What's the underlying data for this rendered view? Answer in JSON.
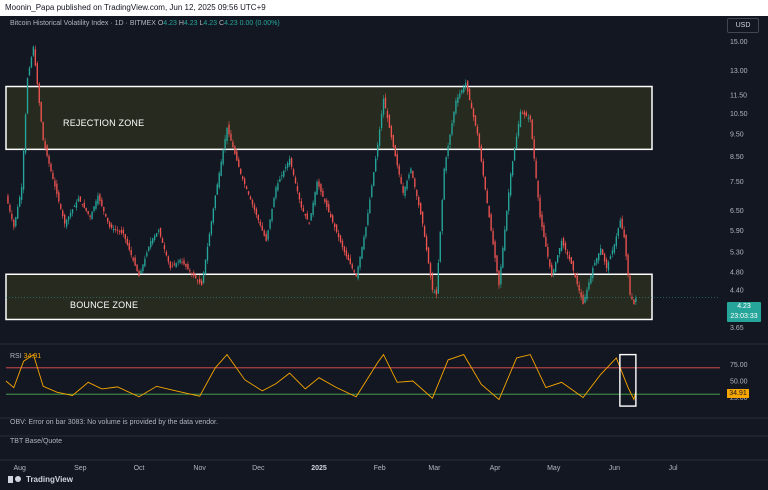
{
  "header": {
    "published_text": "Moonin_Papa published on TradingView.com, Jun 12, 2025 09:56 UTC+9"
  },
  "legend": {
    "symbol": "Bitcoin Historical Volatility Index · 1D · BITMEX",
    "open_label": "O",
    "open": "4.23",
    "high_label": "H",
    "high": "4.23",
    "low_label": "L",
    "low": "4.23",
    "close_label": "C",
    "close": "4.23",
    "change": "0.00 (0.00%)"
  },
  "currency_button": "USD",
  "price_tag": {
    "value": "4.23",
    "countdown": "23:03:33"
  },
  "zones": {
    "rejection": "REJECTION ZONE",
    "bounce": "BOUNCE ZONE"
  },
  "rsi_panel": {
    "label": "RSI",
    "value": "34.91",
    "tag": "34.91"
  },
  "obv_panel": {
    "text": "OBV: Error on bar 3083: No volume is provided by the data vendor."
  },
  "tbt_panel": {
    "text": "TBT Base/Quote"
  },
  "brand": {
    "name": "TradingView"
  },
  "colors": {
    "background": "#131722",
    "bull": "#26a69a",
    "bear": "#ef5350",
    "rsi_line": "#f7a600",
    "zone_fill": "#2a2e1e",
    "zone_border": "#ffffff",
    "rsi_upper": "#ef5350",
    "rsi_lower": "#4caf50"
  },
  "chart_data": [
    {
      "type": "candlestick",
      "title": "",
      "y_scale": "log",
      "ylim": [
        3.4,
        16.5
      ],
      "y_ticks": [
        "15.00",
        "13.00",
        "11.50",
        "10.50",
        "9.50",
        "8.50",
        "7.50",
        "6.50",
        "5.90",
        "5.30",
        "4.80",
        "4.40",
        "3.65"
      ],
      "x_ticks": [
        "Aug",
        "Sep",
        "Oct",
        "Nov",
        "Dec",
        "2025",
        "Feb",
        "Mar",
        "Apr",
        "May",
        "Jun",
        "Jul"
      ],
      "x_range": [
        "2024-07-25",
        "2025-07-25"
      ],
      "last_date": "2025-06-12",
      "last_value": 4.23,
      "zones": [
        {
          "name": "REJECTION ZONE",
          "low": 8.8,
          "high": 12.0
        },
        {
          "name": "BOUNCE ZONE",
          "low": 3.8,
          "high": 4.75
        }
      ],
      "series": [
        {
          "values": [
            {
              "date": "2024-07-25",
              "value": 7.0
            },
            {
              "date": "2024-07-29",
              "value": 6.0
            },
            {
              "date": "2024-08-02",
              "value": 7.3
            },
            {
              "date": "2024-08-05",
              "value": 12.5
            },
            {
              "date": "2024-08-08",
              "value": 14.6
            },
            {
              "date": "2024-08-13",
              "value": 9.2
            },
            {
              "date": "2024-08-18",
              "value": 7.6
            },
            {
              "date": "2024-08-24",
              "value": 6.1
            },
            {
              "date": "2024-08-31",
              "value": 6.9
            },
            {
              "date": "2024-09-06",
              "value": 6.3
            },
            {
              "date": "2024-09-10",
              "value": 7.0
            },
            {
              "date": "2024-09-16",
              "value": 6.0
            },
            {
              "date": "2024-09-23",
              "value": 5.8
            },
            {
              "date": "2024-10-01",
              "value": 4.7
            },
            {
              "date": "2024-10-07",
              "value": 5.6
            },
            {
              "date": "2024-10-11",
              "value": 5.9
            },
            {
              "date": "2024-10-17",
              "value": 4.9
            },
            {
              "date": "2024-10-22",
              "value": 5.1
            },
            {
              "date": "2024-11-02",
              "value": 4.5
            },
            {
              "date": "2024-11-09",
              "value": 7.0
            },
            {
              "date": "2024-11-15",
              "value": 9.8
            },
            {
              "date": "2024-11-22",
              "value": 7.8
            },
            {
              "date": "2024-11-28",
              "value": 6.7
            },
            {
              "date": "2024-12-05",
              "value": 5.6
            },
            {
              "date": "2024-12-10",
              "value": 7.3
            },
            {
              "date": "2024-12-17",
              "value": 8.4
            },
            {
              "date": "2024-12-23",
              "value": 6.6
            },
            {
              "date": "2024-12-27",
              "value": 6.1
            },
            {
              "date": "2024-12-31",
              "value": 7.5
            },
            {
              "date": "2025-01-07",
              "value": 6.3
            },
            {
              "date": "2025-01-14",
              "value": 5.3
            },
            {
              "date": "2025-01-20",
              "value": 4.7
            },
            {
              "date": "2025-01-25",
              "value": 6.0
            },
            {
              "date": "2025-01-31",
              "value": 9.0
            },
            {
              "date": "2025-02-03",
              "value": 11.3
            },
            {
              "date": "2025-02-08",
              "value": 8.9
            },
            {
              "date": "2025-02-13",
              "value": 7.1
            },
            {
              "date": "2025-02-17",
              "value": 8.0
            },
            {
              "date": "2025-02-23",
              "value": 6.1
            },
            {
              "date": "2025-02-28",
              "value": 4.4
            },
            {
              "date": "2025-03-02",
              "value": 4.3
            },
            {
              "date": "2025-03-06",
              "value": 8.0
            },
            {
              "date": "2025-03-12",
              "value": 11.2
            },
            {
              "date": "2025-03-17",
              "value": 12.2
            },
            {
              "date": "2025-03-23",
              "value": 9.5
            },
            {
              "date": "2025-03-29",
              "value": 6.3
            },
            {
              "date": "2025-04-03",
              "value": 4.5
            },
            {
              "date": "2025-04-09",
              "value": 7.8
            },
            {
              "date": "2025-04-14",
              "value": 10.6
            },
            {
              "date": "2025-04-19",
              "value": 10.2
            },
            {
              "date": "2025-04-24",
              "value": 6.3
            },
            {
              "date": "2025-04-30",
              "value": 4.7
            },
            {
              "date": "2025-05-05",
              "value": 5.6
            },
            {
              "date": "2025-05-10",
              "value": 5.0
            },
            {
              "date": "2025-05-16",
              "value": 4.1
            },
            {
              "date": "2025-05-21",
              "value": 4.9
            },
            {
              "date": "2025-05-25",
              "value": 5.4
            },
            {
              "date": "2025-05-28",
              "value": 4.9
            },
            {
              "date": "2025-06-01",
              "value": 5.5
            },
            {
              "date": "2025-06-04",
              "value": 6.2
            },
            {
              "date": "2025-06-06",
              "value": 5.7
            },
            {
              "date": "2025-06-09",
              "value": 4.3
            },
            {
              "date": "2025-06-11",
              "value": 4.1
            },
            {
              "date": "2025-06-12",
              "value": 4.23
            }
          ]
        }
      ]
    },
    {
      "type": "line",
      "title": "RSI",
      "ylim": [
        0,
        100
      ],
      "y_ticks": [
        "75.00",
        "50.00",
        "25.00"
      ],
      "bands": [
        30,
        70
      ],
      "series": [
        {
          "name": "RSI",
          "values": [
            {
              "date": "2024-07-25",
              "value": 50
            },
            {
              "date": "2024-07-29",
              "value": 40
            },
            {
              "date": "2024-08-03",
              "value": 80
            },
            {
              "date": "2024-08-08",
              "value": 90
            },
            {
              "date": "2024-08-13",
              "value": 42
            },
            {
              "date": "2024-08-20",
              "value": 33
            },
            {
              "date": "2024-08-28",
              "value": 28
            },
            {
              "date": "2024-09-05",
              "value": 48
            },
            {
              "date": "2024-09-12",
              "value": 38
            },
            {
              "date": "2024-09-20",
              "value": 41
            },
            {
              "date": "2024-10-01",
              "value": 26
            },
            {
              "date": "2024-10-10",
              "value": 42
            },
            {
              "date": "2024-10-20",
              "value": 35
            },
            {
              "date": "2024-11-01",
              "value": 27
            },
            {
              "date": "2024-11-09",
              "value": 70
            },
            {
              "date": "2024-11-15",
              "value": 90
            },
            {
              "date": "2024-11-24",
              "value": 52
            },
            {
              "date": "2024-12-03",
              "value": 35
            },
            {
              "date": "2024-12-10",
              "value": 46
            },
            {
              "date": "2024-12-17",
              "value": 62
            },
            {
              "date": "2024-12-25",
              "value": 38
            },
            {
              "date": "2025-01-01",
              "value": 55
            },
            {
              "date": "2025-01-10",
              "value": 40
            },
            {
              "date": "2025-01-20",
              "value": 26
            },
            {
              "date": "2025-01-31",
              "value": 78
            },
            {
              "date": "2025-02-03",
              "value": 90
            },
            {
              "date": "2025-02-10",
              "value": 48
            },
            {
              "date": "2025-02-18",
              "value": 50
            },
            {
              "date": "2025-02-28",
              "value": 24
            },
            {
              "date": "2025-03-08",
              "value": 82
            },
            {
              "date": "2025-03-16",
              "value": 90
            },
            {
              "date": "2025-03-25",
              "value": 45
            },
            {
              "date": "2025-04-03",
              "value": 22
            },
            {
              "date": "2025-04-12",
              "value": 85
            },
            {
              "date": "2025-04-19",
              "value": 90
            },
            {
              "date": "2025-04-27",
              "value": 40
            },
            {
              "date": "2025-05-05",
              "value": 48
            },
            {
              "date": "2025-05-16",
              "value": 25
            },
            {
              "date": "2025-05-25",
              "value": 60
            },
            {
              "date": "2025-06-02",
              "value": 85
            },
            {
              "date": "2025-06-08",
              "value": 40
            },
            {
              "date": "2025-06-11",
              "value": 22
            },
            {
              "date": "2025-06-12",
              "value": 34.91
            }
          ]
        }
      ]
    }
  ]
}
